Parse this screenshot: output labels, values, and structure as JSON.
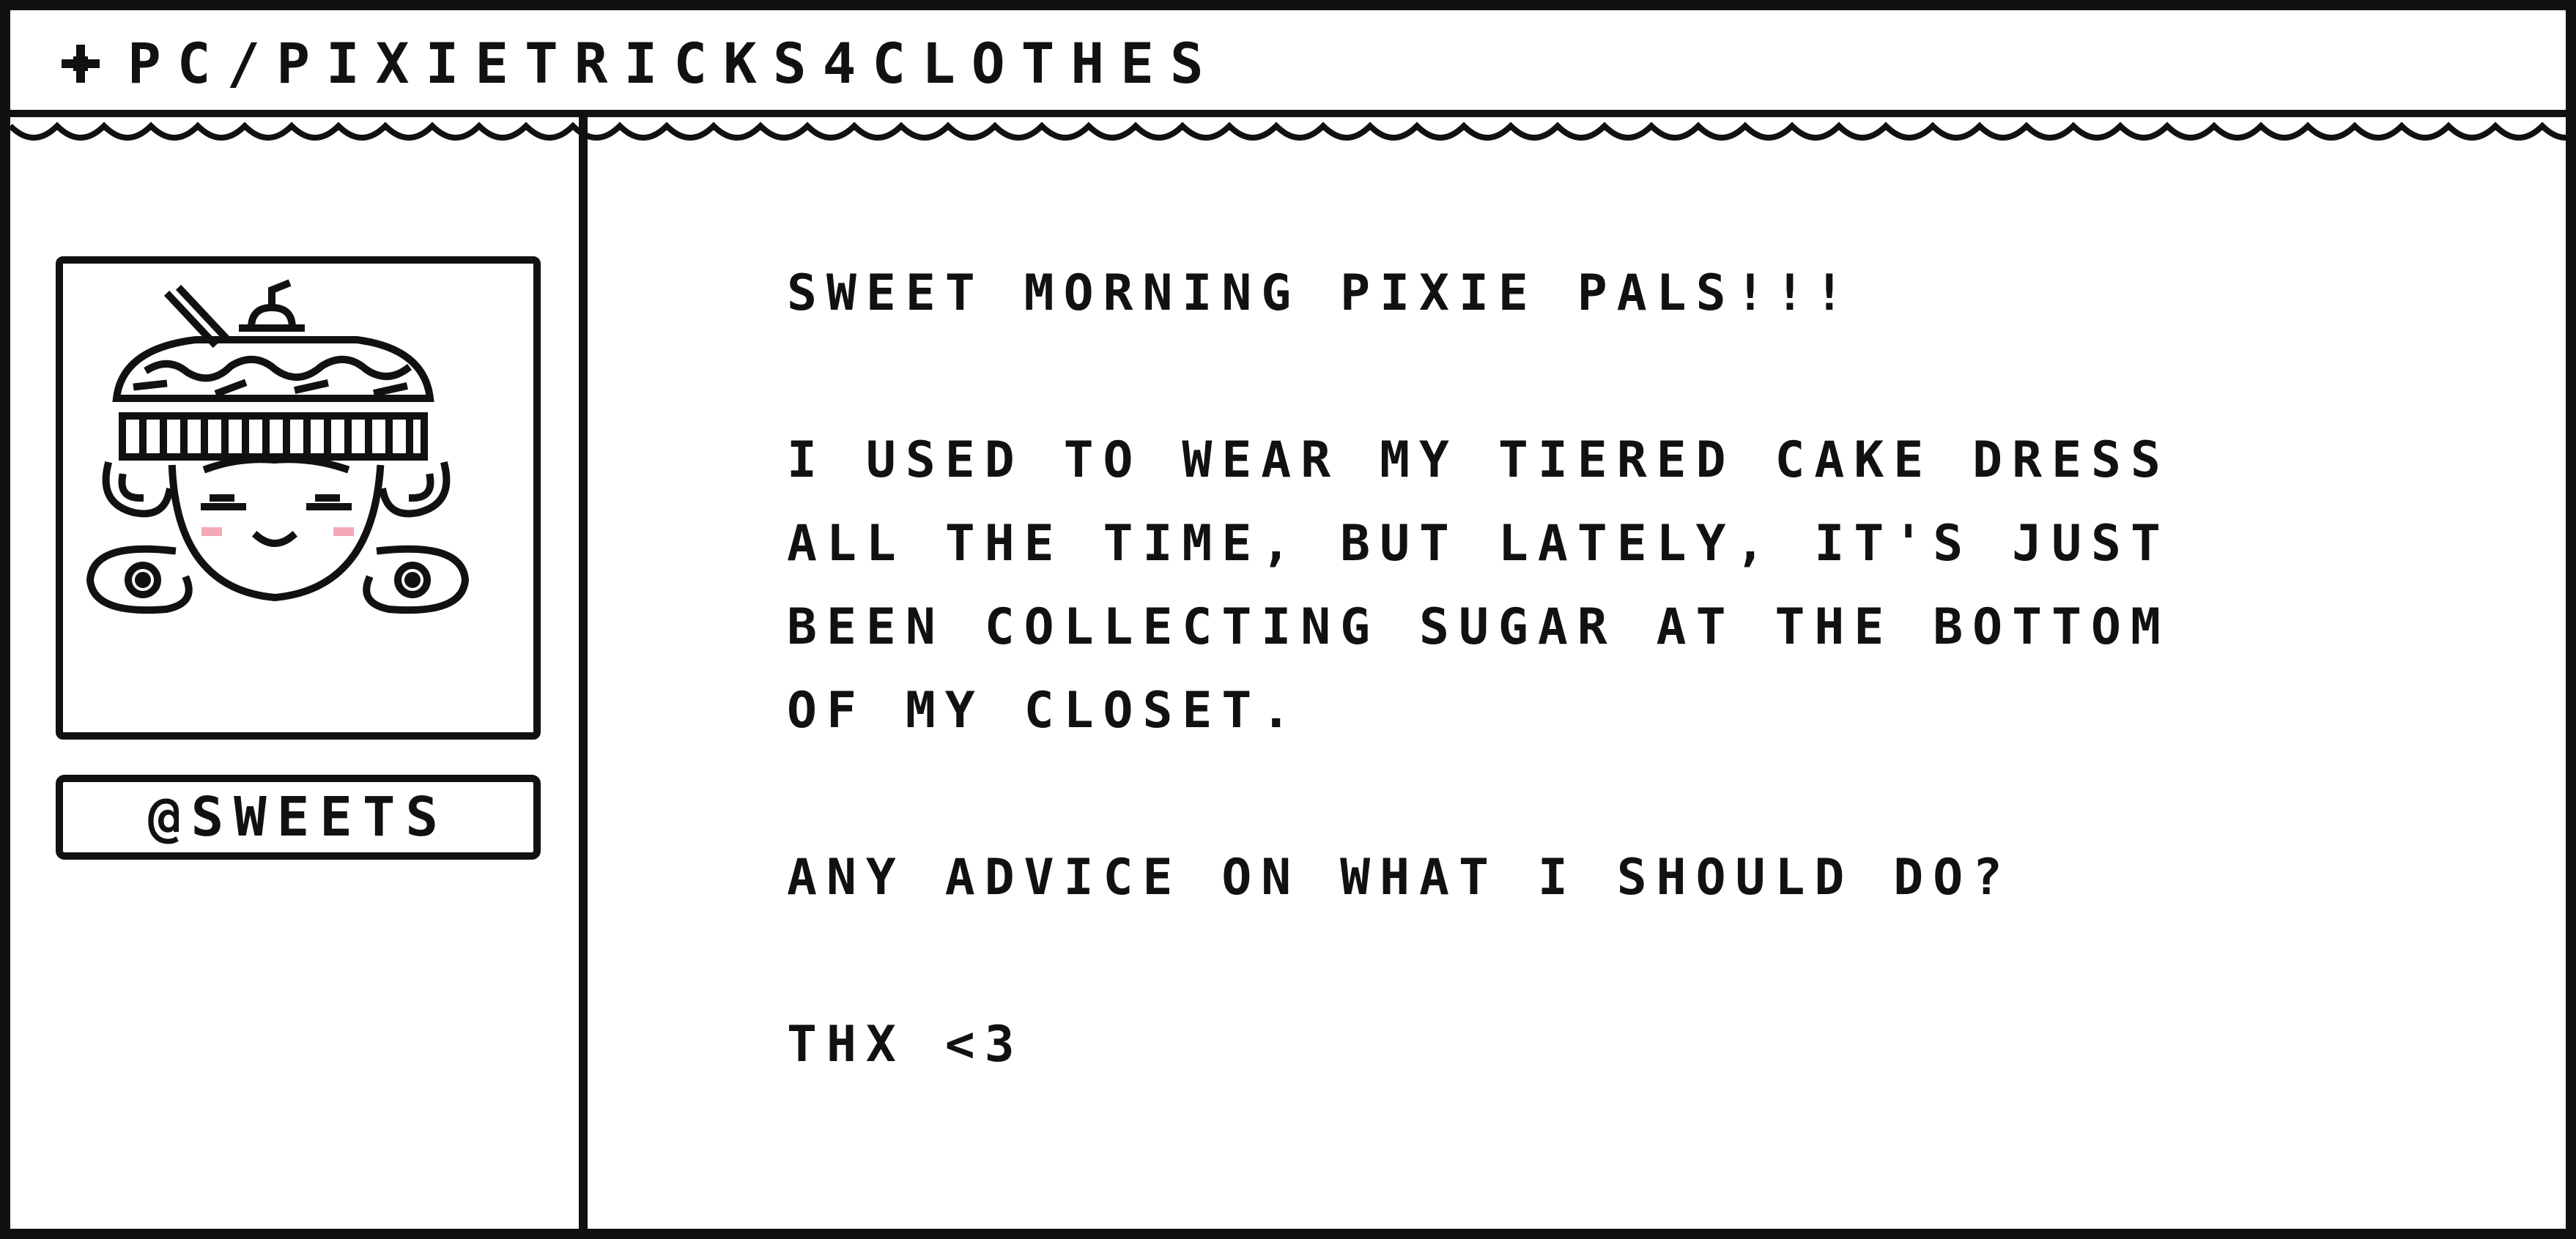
{
  "titlebar": {
    "icon": "sparkle-icon",
    "title": "PC/PIXIETRICKS4CLOTHES"
  },
  "profile": {
    "avatar_icon": "cupcake-girl-avatar",
    "username": "@SWEETS"
  },
  "post": {
    "greeting": "SWEET MORNING PIXIE PALS!!!",
    "body_lines": [
      "I USED TO WEAR MY TIERED CAKE DRESS",
      "ALL THE TIME, BUT LATELY, IT'S JUST",
      "BEEN COLLECTING SUGAR AT THE BOTTOM",
      "OF MY CLOSET."
    ],
    "question": "ANY ADVICE ON WHAT I SHOULD DO?",
    "signoff": "THX <3"
  },
  "colors": {
    "ink": "#111111",
    "background": "#ffffff",
    "blush": "#f4a8b8"
  }
}
